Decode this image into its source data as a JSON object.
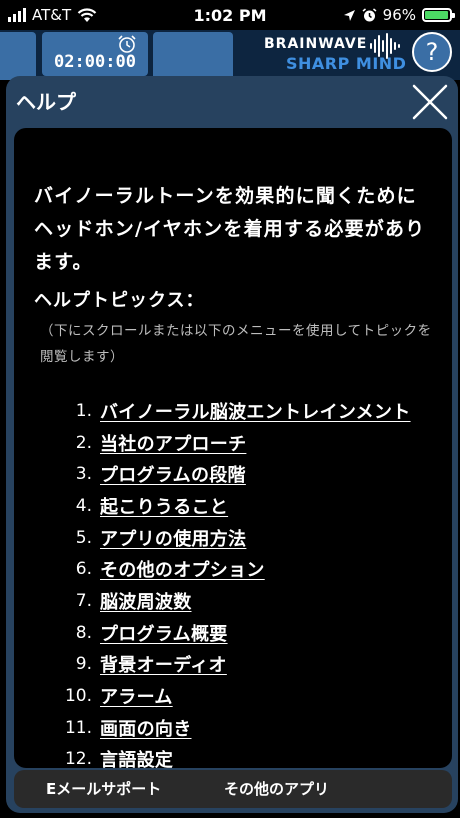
{
  "status_bar": {
    "carrier": "AT&T",
    "time": "1:02 PM",
    "battery": "96%"
  },
  "app_header": {
    "timer": "02:00:00",
    "brand_line1": "BRAINWAVE",
    "brand_line2": "SHARP MIND",
    "help_button": "?"
  },
  "modal": {
    "title": "ヘルプ",
    "intro": "バイノーラルトーンを効果的に聞くためにヘッドホン/イヤホンを着用する必要があります。",
    "topics_title": "ヘルプトピックス：",
    "topics_subtitle": "（下にスクロールまたは以下のメニューを使用してトピックを閲覧します）",
    "topics": [
      {
        "num": "1.",
        "label": "バイノーラル脳波エントレインメント"
      },
      {
        "num": "2.",
        "label": "当社のアプローチ"
      },
      {
        "num": "3.",
        "label": "プログラムの段階"
      },
      {
        "num": "4.",
        "label": "起こりうること"
      },
      {
        "num": "5.",
        "label": "アプリの使用方法"
      },
      {
        "num": "6.",
        "label": "その他のオプション"
      },
      {
        "num": "7.",
        "label": "脳波周波数"
      },
      {
        "num": "8.",
        "label": "プログラム概要"
      },
      {
        "num": "9.",
        "label": "背景オーディオ"
      },
      {
        "num": "10.",
        "label": "アラーム"
      },
      {
        "num": "11.",
        "label": "画面の向き"
      },
      {
        "num": "12.",
        "label": "言語設定"
      }
    ],
    "footer": {
      "email_support": "Eメールサポート",
      "other_apps": "その他のアプリ"
    }
  },
  "colors": {
    "header_bg": "#0d2540",
    "tab_blue": "#3a6ea5",
    "brand_blue": "#3f8fe0",
    "modal_frame": "#27425f",
    "battery_green": "#4cd964"
  }
}
